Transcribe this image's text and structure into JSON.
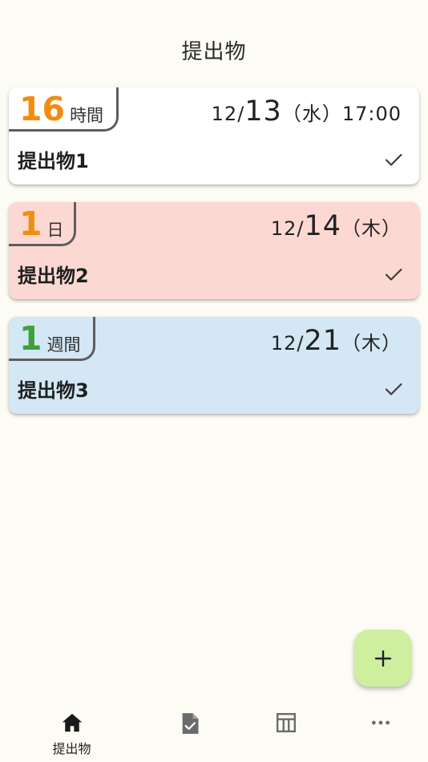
{
  "header": {
    "title": "提出物"
  },
  "colors": {
    "background": "#fcfbf4",
    "orange": "#f28c0f",
    "green": "#3ca23a",
    "card_white": "#ffffff",
    "card_pink": "#fbd9d2",
    "card_blue": "#d3e7f4",
    "fab": "#cdef9e"
  },
  "cards": [
    {
      "remaining_number": "16",
      "remaining_unit": "時間",
      "date_month": "12/",
      "date_day": "13",
      "date_weekday": "（水）",
      "date_time": "17:00",
      "title": "提出物1",
      "check_icon": "checkmark-icon"
    },
    {
      "remaining_number": "1",
      "remaining_unit": "日",
      "date_month": "12/",
      "date_day": "14",
      "date_weekday": "（木）",
      "title": "提出物2",
      "check_icon": "checkmark-icon"
    },
    {
      "remaining_number": "1",
      "remaining_unit": "週間",
      "date_month": "12/",
      "date_day": "21",
      "date_weekday": "（木）",
      "title": "提出物3",
      "check_icon": "checkmark-icon"
    }
  ],
  "fab": {
    "label": "+",
    "icon": "plus-icon"
  },
  "bottom_nav": [
    {
      "icon": "home-icon",
      "label": "提出物",
      "active": true
    },
    {
      "icon": "document-check-icon",
      "label": ""
    },
    {
      "icon": "table-icon",
      "label": ""
    },
    {
      "icon": "more-horizontal-icon",
      "label": ""
    }
  ]
}
